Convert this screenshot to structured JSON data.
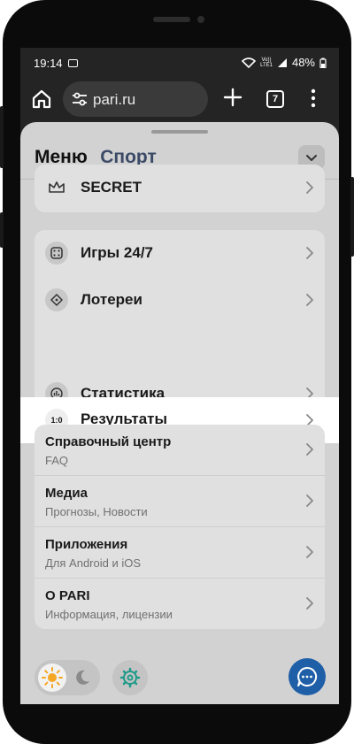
{
  "statusbar": {
    "time": "19:14",
    "volte_top": "Vo))",
    "volte_bottom": "LTE1",
    "battery": "48%"
  },
  "browser": {
    "url": "pari.ru",
    "tab_count": "7"
  },
  "tabs": {
    "menu": "Меню",
    "sport": "Спорт"
  },
  "secret": {
    "label": "SECRET"
  },
  "games_card": [
    {
      "label": "Игры 24/7"
    },
    {
      "label": "Лотереи"
    },
    {
      "label": "Результаты",
      "icon_text": "1:0"
    },
    {
      "label": "Статистика"
    }
  ],
  "info_card": [
    {
      "title": "Справочный центр",
      "subtitle": "FAQ"
    },
    {
      "title": "Медиа",
      "subtitle": "Прогнозы, Новости"
    },
    {
      "title": "Приложения",
      "subtitle": "Для Android и iOS"
    },
    {
      "title": "О PARI",
      "subtitle": "Информация, лицензии"
    }
  ],
  "colors": {
    "accent_blue": "#1f5fa8",
    "sun": "#f5a623",
    "settings_teal": "#1f9a8a",
    "highlight": "#ffffff"
  }
}
